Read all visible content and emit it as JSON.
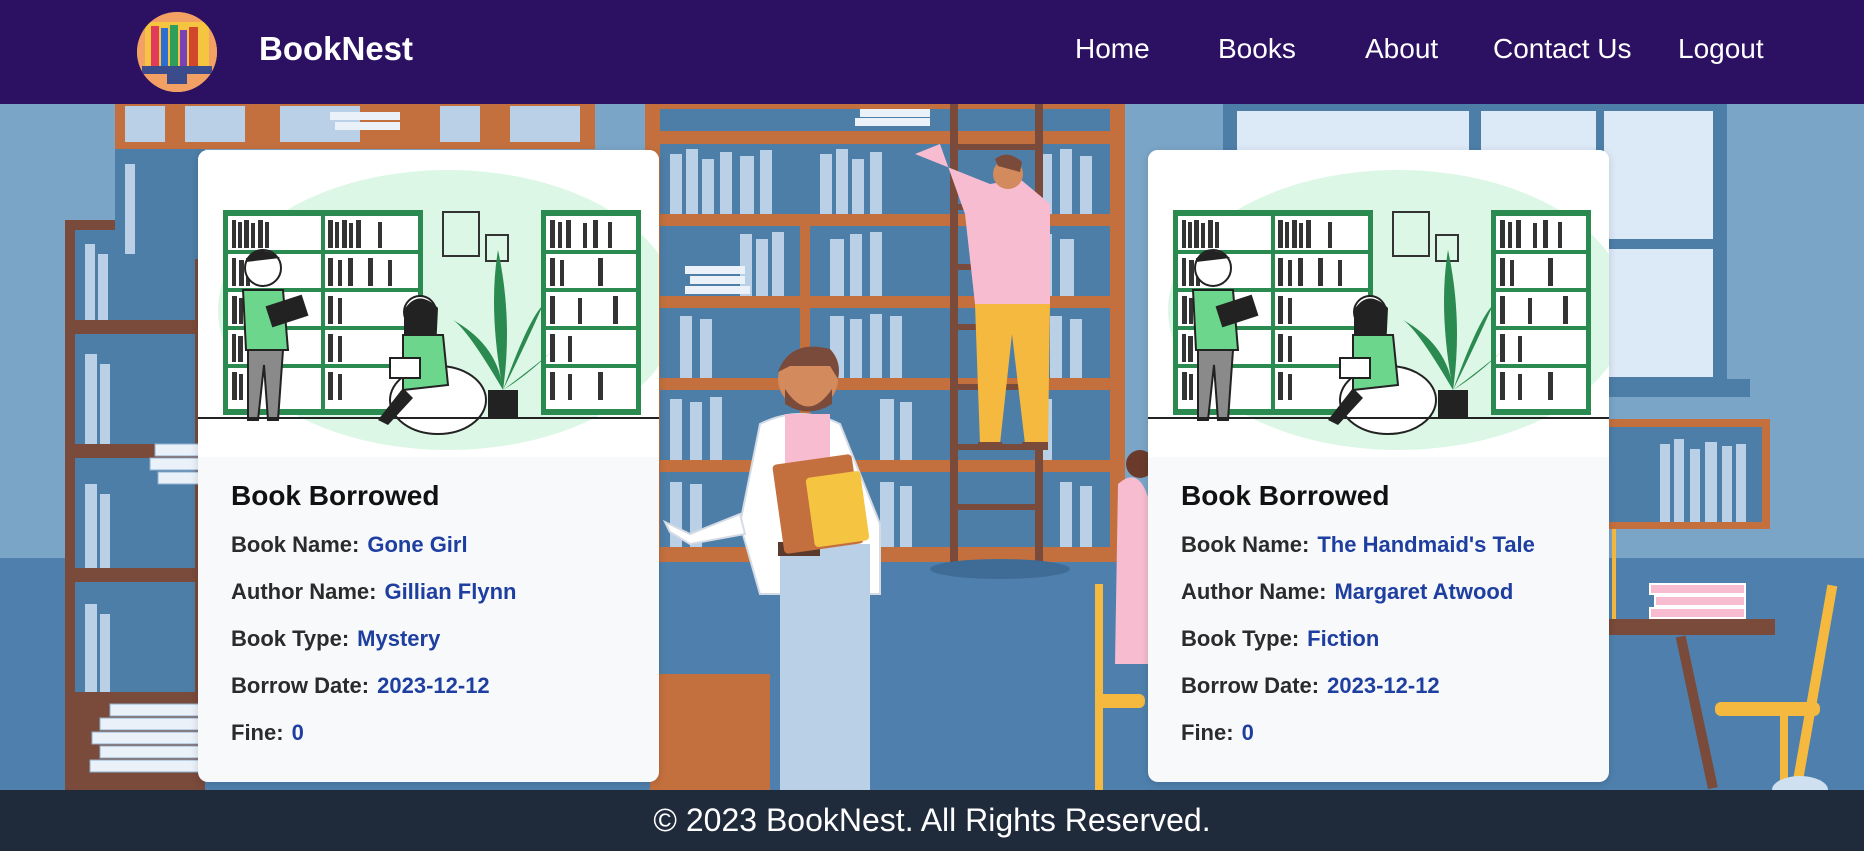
{
  "brand": {
    "name": "BookNest"
  },
  "nav": {
    "items": [
      "Home",
      "Books",
      "About",
      "Contact Us",
      "Logout"
    ]
  },
  "cards": [
    {
      "title": "Book Borrowed",
      "labels": {
        "name": "Book Name:",
        "author": "Author Name:",
        "type": "Book Type:",
        "date": "Borrow Date:",
        "fine": "Fine:"
      },
      "book_name": "Gone Girl",
      "author": "Gillian Flynn",
      "book_type": "Mystery",
      "borrow_date": "2023-12-12",
      "fine": "0"
    },
    {
      "title": "Book Borrowed",
      "labels": {
        "name": "Book Name:",
        "author": "Author Name:",
        "type": "Book Type:",
        "date": "Borrow Date:",
        "fine": "Fine:"
      },
      "book_name": "The Handmaid's Tale",
      "author": "Margaret Atwood",
      "book_type": "Fiction",
      "borrow_date": "2023-12-12",
      "fine": "0"
    }
  ],
  "footer": {
    "text": "© 2023 BookNest. All Rights Reserved."
  },
  "colors": {
    "navbar": "#2c1162",
    "footer": "#1f2a3b",
    "value_text": "#1e3fa0",
    "scene_bg": "#5b86ad"
  }
}
